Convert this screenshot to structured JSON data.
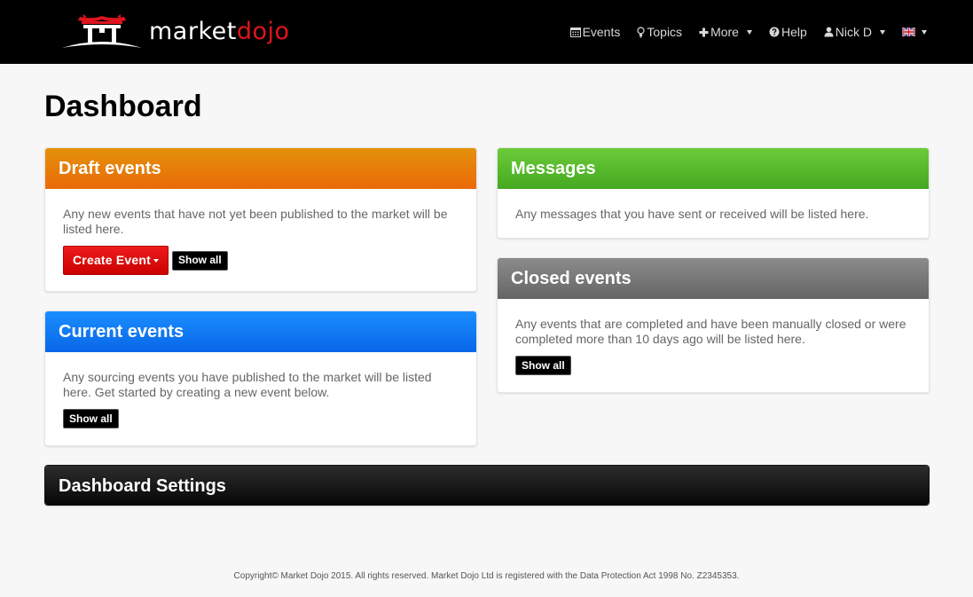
{
  "brand": {
    "name_part1": "market",
    "name_part2": "dojo",
    "accent_color": "#e0141e"
  },
  "nav": {
    "events": "Events",
    "topics": "Topics",
    "more": "More",
    "help": "Help",
    "user": "Nick D"
  },
  "page": {
    "title": "Dashboard"
  },
  "panels": {
    "draft": {
      "title": "Draft events",
      "text": "Any new events that have not yet been published to the market will be listed here.",
      "create_label": "Create Event",
      "show_all": "Show all",
      "color": "#ea7a09"
    },
    "current": {
      "title": "Current events",
      "text": "Any sourcing events you have published to the market will be listed here. Get started by creating a new event below.",
      "show_all": "Show all",
      "color": "#1178f5"
    },
    "messages": {
      "title": "Messages",
      "text": "Any messages that you have sent or received will be listed here.",
      "color": "#55b82a"
    },
    "closed": {
      "title": "Closed events",
      "text": "Any events that are completed and have been manually closed or were completed more than 10 days ago will be listed here.",
      "show_all": "Show all",
      "color": "#777777"
    },
    "settings": {
      "title": "Dashboard Settings",
      "color": "#111111"
    }
  },
  "footer": {
    "text": "Copyright© Market Dojo 2015. All rights reserved. Market Dojo Ltd is registered with the Data Protection Act 1998 No. Z2345353."
  }
}
